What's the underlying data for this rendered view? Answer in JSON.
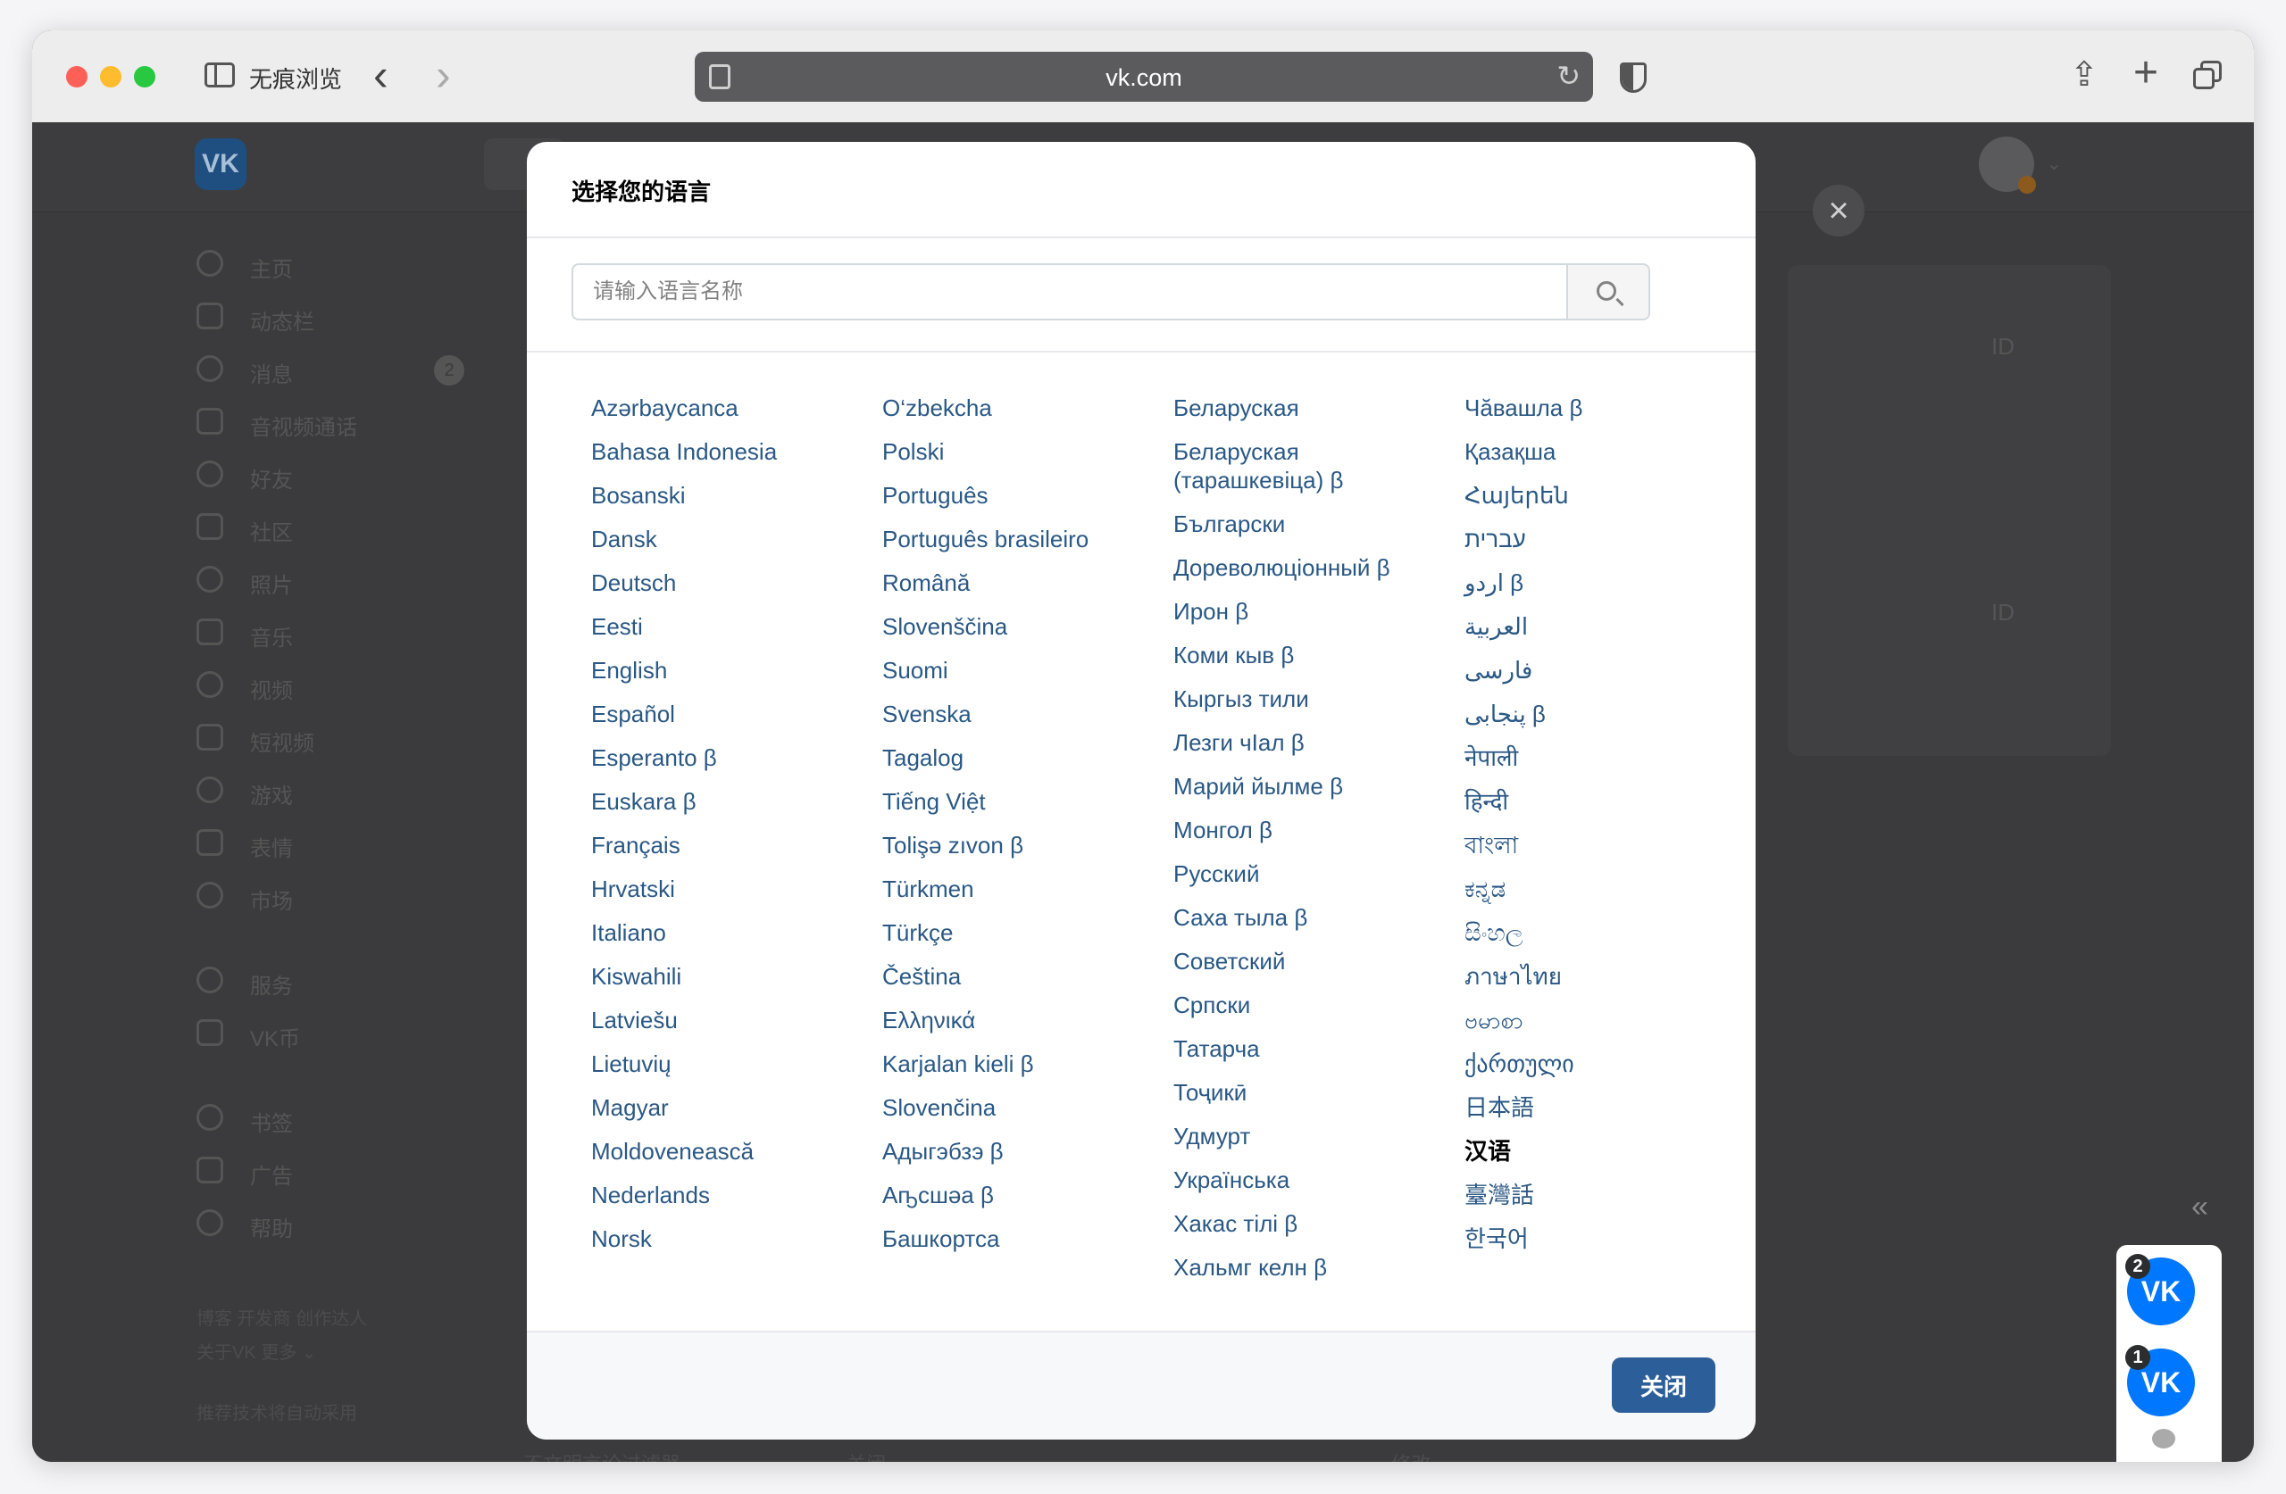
{
  "browser": {
    "mode_label": "无痕浏览",
    "url": "vk.com"
  },
  "sidebar": {
    "items": [
      {
        "label": "主页",
        "icon": "user-circle-icon"
      },
      {
        "label": "动态栏",
        "icon": "feed-icon"
      },
      {
        "label": "消息",
        "icon": "message-icon",
        "badge": "2"
      },
      {
        "label": "音视频通话",
        "icon": "phone-icon"
      },
      {
        "label": "好友",
        "icon": "friends-icon"
      },
      {
        "label": "社区",
        "icon": "community-icon"
      },
      {
        "label": "照片",
        "icon": "photo-icon"
      },
      {
        "label": "音乐",
        "icon": "music-icon"
      },
      {
        "label": "视频",
        "icon": "video-icon"
      },
      {
        "label": "短视频",
        "icon": "clips-icon"
      },
      {
        "label": "游戏",
        "icon": "games-icon"
      },
      {
        "label": "表情",
        "icon": "sticker-icon"
      },
      {
        "label": "市场",
        "icon": "market-icon"
      }
    ],
    "items2": [
      {
        "label": "服务",
        "icon": "services-icon"
      },
      {
        "label": "VK币",
        "icon": "coins-icon"
      }
    ],
    "items3": [
      {
        "label": "书签",
        "icon": "bookmark-icon"
      },
      {
        "label": "广告",
        "icon": "ads-icon"
      },
      {
        "label": "帮助",
        "icon": "help-icon"
      }
    ],
    "footer": {
      "line1": "博客   开发商   创作达人",
      "line2": "关于VK   更多 ⌄",
      "note": "推荐技术将自动采用"
    }
  },
  "background": {
    "id_label": "ID",
    "bottom_text_1": "不文明言论过滤器",
    "bottom_text_2": "关闭",
    "bottom_text_3": "修改"
  },
  "chat_panel": {
    "count1": "2",
    "count2": "1",
    "vk_logo": "VK"
  },
  "modal": {
    "title": "选择您的语言",
    "search_placeholder": "请输入语言名称",
    "close_label": "关闭",
    "columns": [
      [
        "Azərbaycanca",
        "Bahasa Indonesia",
        "Bosanski",
        "Dansk",
        "Deutsch",
        "Eesti",
        "English",
        "Español",
        "Esperanto  β",
        "Euskara  β",
        "Français",
        "Hrvatski",
        "Italiano",
        "Kiswahili",
        "Latviešu",
        "Lietuvių",
        "Magyar",
        "Moldovenească",
        "Nederlands",
        "Norsk"
      ],
      [
        "O‘zbekcha",
        "Polski",
        "Português",
        "Português brasileiro",
        "Română",
        "Slovenščina",
        "Suomi",
        "Svenska",
        "Tagalog",
        "Tiếng Việt",
        "Tolişə zıvon  β",
        "Türkmen",
        "Türkçe",
        "Čeština",
        "Ελληνικά",
        "Karjalan kieli  β",
        "Slovenčina",
        "Адыгэбзэ  β",
        "Аҧсшәа  β",
        "Башкортса"
      ],
      [
        "Беларуская",
        "Беларуская (тарашкевіца)  β",
        "Български",
        "Дореволюціонный  β",
        "Ирон  β",
        "Коми кыв  β",
        "Кыргыз тили",
        "Лезги чIал  β",
        "Марий йылме  β",
        "Монгол  β",
        "Русский",
        "Саха тыла  β",
        "Советский",
        "Српски",
        "Татарча",
        "Тоҷикӣ",
        "Удмурт",
        "Українська",
        "Хакас тілі  β",
        "Хальмг келн  β"
      ],
      [
        "Чăвашла  β",
        "Қазақша",
        "Հայերեն",
        "עברית",
        "اردو  β",
        "العربية",
        "فارسی",
        "پنجابی  β",
        "नेपाली",
        "हिन्दी",
        "বাংলা",
        "ಕನ್ನಡ",
        "සිංහල",
        "ภาษาไทย",
        "ဗမာစာ",
        "ქართული",
        "日本語",
        "汉语",
        "臺灣話",
        "한국어"
      ]
    ],
    "selected": "汉语"
  }
}
